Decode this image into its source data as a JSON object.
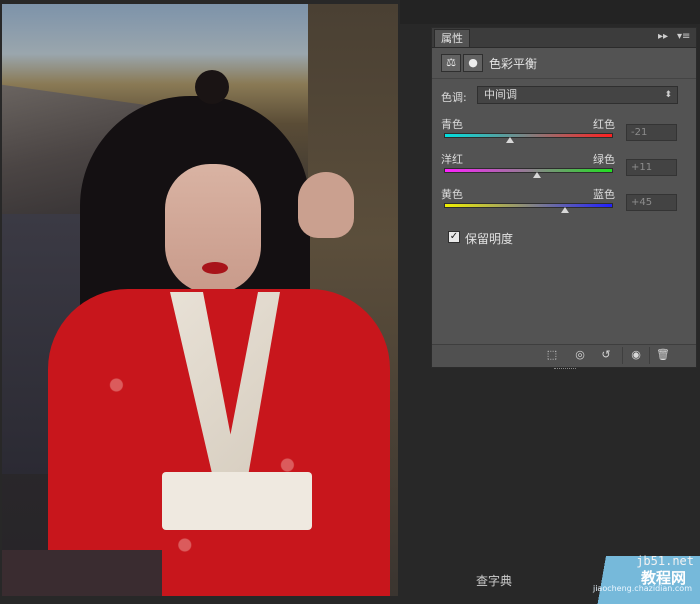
{
  "panel": {
    "tab_label": "属性",
    "collapse_glyph": "▸▸",
    "menu_glyph": "▾≡",
    "title": "色彩平衡",
    "tone_label": "色调:",
    "tone_value": "中间调",
    "sliders": [
      {
        "left": "青色",
        "right": "红色",
        "value": "-21",
        "level": -21
      },
      {
        "left": "洋红",
        "right": "绿色",
        "value": "+11",
        "level": 11
      },
      {
        "left": "黄色",
        "right": "蓝色",
        "value": "+45",
        "level": 45
      }
    ],
    "preserve_label": "保留明度",
    "preserve_checked": true,
    "footer_icons": [
      "clip-to-layer-icon",
      "view-previous-state-icon",
      "reset-icon",
      "visibility-eye-icon",
      "delete-trash-icon"
    ]
  },
  "watermark": {
    "site": "jb51.net",
    "main": "教程网",
    "url": "jiaocheng.chazidian.com",
    "side": "查字典"
  },
  "colors": {
    "panel_bg": "#535353",
    "workspace_bg": "#282828"
  }
}
